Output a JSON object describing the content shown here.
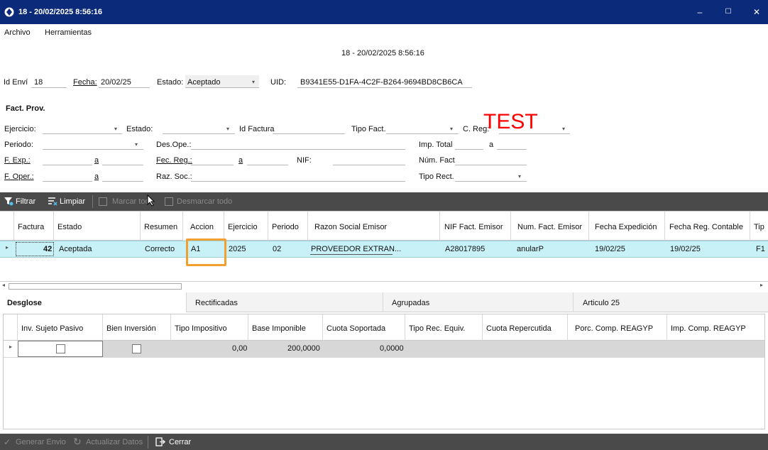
{
  "window": {
    "title": "18 - 20/02/2025 8:56:16",
    "minimize": "–",
    "maximize": "☐",
    "close": "✕"
  },
  "menu": {
    "archivo": "Archivo",
    "herramientas": "Herramientas"
  },
  "header": {
    "subtitle": "18 - 20/02/2025 8:56:16",
    "id_label": "Id Enví",
    "id_value": "18",
    "fecha_label": "Fecha:",
    "fecha_value": "20/02/25",
    "estado_label": "Estado:",
    "estado_value": "Aceptado",
    "uid_label": "UID:",
    "uid_value": "B9341E55-D1FA-4C2F-B264-9694BD8CB6CA",
    "test": "TEST"
  },
  "filters": {
    "section_title": "Fact. Prov.",
    "ejercicio": "Ejercicio:",
    "estado": "Estado:",
    "id_factura": "Id Factura",
    "tipo_fact": "Tipo Fact.",
    "c_reg": "C. Reg:",
    "periodo": "Periodo:",
    "des_ope": "Des.Ope.:",
    "imp_total": "Imp. Total",
    "a": "a",
    "f_exp": "F. Exp.:",
    "fec_reg": "Fec. Reg.:",
    "nif": "NIF:",
    "num_fact": "Núm. Fact",
    "f_oper": "F. Oper.:",
    "raz_soc": "Raz. Soc.:",
    "tipo_rect": "Tipo Rect."
  },
  "toolbar": {
    "filtrar": "Filtrar",
    "limpiar": "Limpiar",
    "marcar_todo": "Marcar todo",
    "desmarcar_todo": "Desmarcar todo"
  },
  "grid1": {
    "columns": [
      "Factura",
      "Estado",
      "Resumen",
      "Accion",
      "Ejercicio",
      "Periodo",
      "Razon Social Emisor",
      "NIF Fact. Emisor",
      "Num. Fact. Emisor",
      "Fecha Expedición",
      "Fecha Reg. Contable",
      "Tip"
    ],
    "row": {
      "factura": "42",
      "estado": "Aceptada",
      "resumen": "Correcto",
      "accion": "A1",
      "ejercicio": "2025",
      "periodo": "02",
      "razon": "PROVEEDOR EXTRAN...",
      "nif": "A28017895",
      "num": "anularP",
      "fecha_exp": "19/02/25",
      "fecha_reg": "19/02/25",
      "tip": "F1"
    }
  },
  "tabs": [
    "Desglose",
    "Rectificadas",
    "Agrupadas",
    "Articulo 25"
  ],
  "grid2": {
    "columns": [
      "Inv. Sujeto Pasivo",
      "Bien Inversión",
      "Tipo Impositivo",
      "Base Imponible",
      "Cuota Soportada",
      "Tipo Rec. Equiv.",
      "Cuota Repercutida",
      "Porc. Comp. REAGYP",
      "Imp. Comp. REAGYP"
    ],
    "row": {
      "tipo": "0,00",
      "base": "200,0000",
      "cuota": "0,0000"
    }
  },
  "bottom": {
    "generar": "Generar Envio",
    "actualizar": "Actualizar Datos",
    "cerrar": "Cerrar"
  }
}
